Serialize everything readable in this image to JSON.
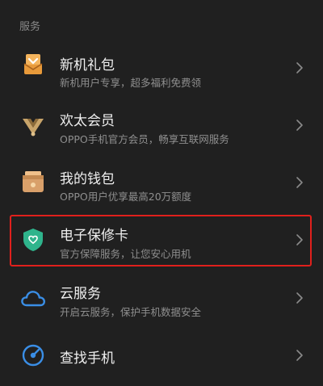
{
  "section": {
    "header": "服务"
  },
  "items": [
    {
      "title": "新机礼包",
      "subtitle": "新机用户专享，超多福利免费领",
      "icon": "gift-box-icon",
      "color": "#e89a3a"
    },
    {
      "title": "欢太会员",
      "subtitle": "OPPO手机官方会员，畅享互联网服务",
      "icon": "membership-badge-icon",
      "color": "#c8a46a"
    },
    {
      "title": "我的钱包",
      "subtitle": "OPPO用户优享最高20万额度",
      "icon": "wallet-icon",
      "color": "#d9a06a"
    },
    {
      "title": "电子保修卡",
      "subtitle": "官方保障服务，让您安心用机",
      "icon": "shield-heart-icon",
      "color": "#2fb48c"
    },
    {
      "title": "云服务",
      "subtitle": "开启云服务，保护手机数据安全",
      "icon": "cloud-icon",
      "color": "#3a8ee6"
    },
    {
      "title": "查找手机",
      "subtitle": "",
      "icon": "locate-phone-icon",
      "color": "#3a8ee6"
    }
  ],
  "annotation": {
    "color": "#e0201c",
    "highlighted_item": "电子保修卡"
  }
}
